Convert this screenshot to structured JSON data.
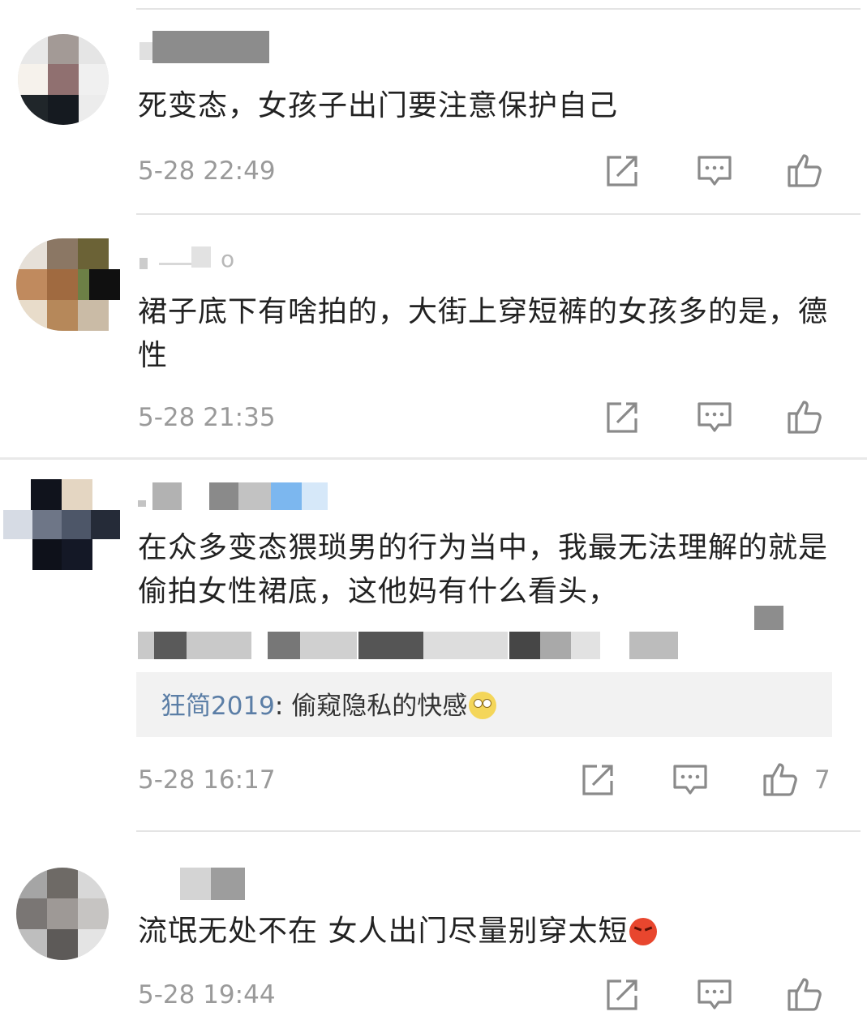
{
  "comments": [
    {
      "name_fragment": "",
      "text": "死变态，女孩子出门要注意保护自己",
      "time": "5-28 22:49",
      "likes": ""
    },
    {
      "name_fragment": "o",
      "text": "裙子底下有啥拍的，大街上穿短裤的女孩多的是，德性",
      "time": "5-28 21:35",
      "likes": ""
    },
    {
      "name_fragment": "",
      "text": "在众多变态猥琐男的行为当中，我最无法理解的就是偷拍女性裙底，这他妈有什么看头，",
      "time": "5-28 16:17",
      "likes": "7",
      "reply": {
        "user": "狂简2019",
        "separator": ": ",
        "text": "偷窥隐私的快感",
        "emoji": "eye-roll-emoji"
      }
    },
    {
      "name_fragment": "",
      "text": "流氓无处不在 女人出门尽量别穿太短",
      "emoji": "angry-emoji",
      "time": "5-28 19:44",
      "likes": ""
    }
  ],
  "icons": [
    "share-icon",
    "comment-icon",
    "like-icon"
  ],
  "colors": {
    "text": "#222222",
    "time": "#9a9a9a",
    "divider": "#e4e4e4",
    "reply_user": "#5b7ea6",
    "reply_bg": "#f2f2f2"
  }
}
